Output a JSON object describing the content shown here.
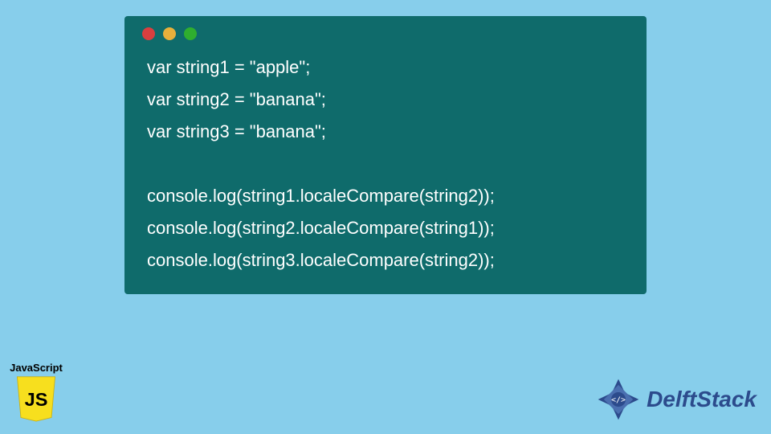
{
  "code": {
    "lines": [
      "var string1 = \"apple\";",
      "var string2 = \"banana\";",
      "var string3 = \"banana\";",
      "",
      "console.log(string1.localeCompare(string2));",
      "console.log(string2.localeCompare(string1));",
      "console.log(string3.localeCompare(string2));"
    ]
  },
  "window": {
    "dot_colors": {
      "red": "#d93f3f",
      "yellow": "#e8b03b",
      "green": "#2fae2f"
    }
  },
  "js_badge": {
    "label": "JavaScript",
    "logo_letters": "JS"
  },
  "brand": {
    "name": "DelftStack"
  },
  "colors": {
    "page_bg": "#87ceeb",
    "code_bg": "#0f6b6b",
    "code_fg": "#ffffff",
    "brand_fg": "#2c4b8c",
    "js_yellow": "#f7df1e"
  }
}
